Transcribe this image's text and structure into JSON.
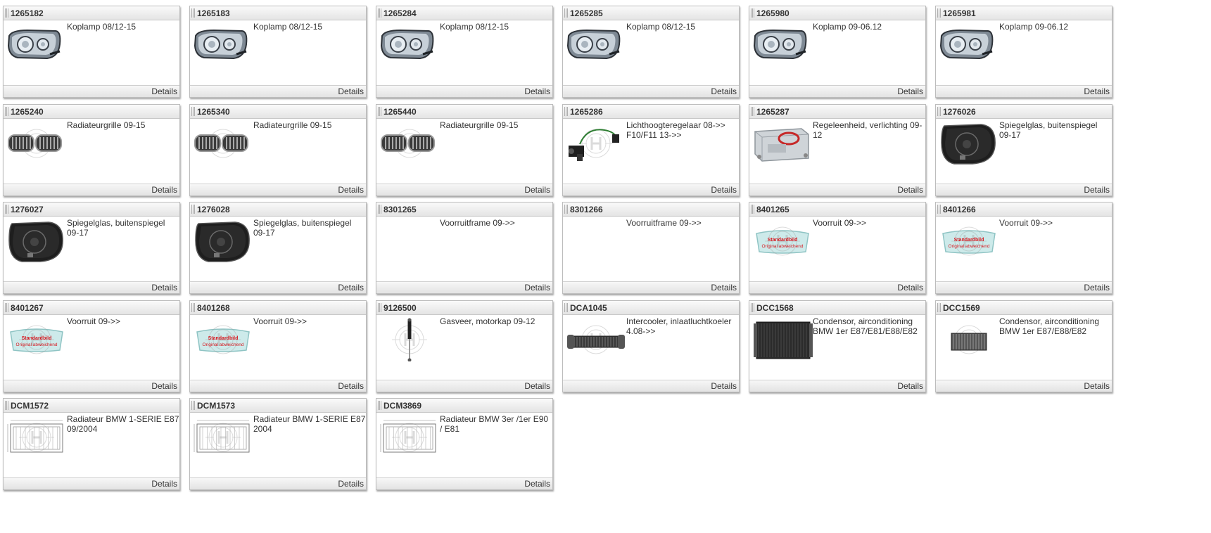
{
  "details_label": "Details",
  "watermark_badge": {
    "line1": "Standardbild",
    "line2": "Original abweichend"
  },
  "colors": {
    "card_border": "#bdbdbd",
    "header_bg": "#e8e8e8",
    "text": "#333333",
    "badge_red": "#d71920"
  },
  "products": [
    {
      "id": "1265182",
      "description": "Koplamp 08/12-15",
      "icon": "headlamp-icon"
    },
    {
      "id": "1265183",
      "description": "Koplamp 08/12-15",
      "icon": "headlamp-icon"
    },
    {
      "id": "1265284",
      "description": "Koplamp 08/12-15",
      "icon": "headlamp-icon"
    },
    {
      "id": "1265285",
      "description": "Koplamp 08/12-15",
      "icon": "headlamp-icon"
    },
    {
      "id": "1265980",
      "description": "Koplamp 09-06.12",
      "icon": "headlamp-icon"
    },
    {
      "id": "1265981",
      "description": "Koplamp 09-06.12",
      "icon": "headlamp-icon"
    },
    {
      "id": "1265240",
      "description": "Radiateurgrille 09-15",
      "icon": "kidney-grille-icon"
    },
    {
      "id": "1265340",
      "description": "Radiateurgrille 09-15",
      "icon": "kidney-grille-icon"
    },
    {
      "id": "1265440",
      "description": "Radiateurgrille 09-15",
      "icon": "kidney-grille-icon"
    },
    {
      "id": "1265286",
      "description": "Lichthoogteregelaar 08->> F10/F11 13->>",
      "icon": "headlight-leveling-motor-icon"
    },
    {
      "id": "1265287",
      "description": "Regeleenheid, verlichting 09-12",
      "icon": "control-unit-icon"
    },
    {
      "id": "1276026",
      "description": "Spiegelglas, buitenspiegel 09-17",
      "icon": "mirror-glass-icon"
    },
    {
      "id": "1276027",
      "description": "Spiegelglas, buitenspiegel 09-17",
      "icon": "mirror-glass-icon"
    },
    {
      "id": "1276028",
      "description": "Spiegelglas, buitenspiegel 09-17",
      "icon": "mirror-glass-icon"
    },
    {
      "id": "8301265",
      "description": "Voorruitframe 09->>",
      "icon": "none"
    },
    {
      "id": "8301266",
      "description": "Voorruitframe 09->>",
      "icon": "none"
    },
    {
      "id": "8401265",
      "description": "Voorruit 09->>",
      "icon": "windshield-icon"
    },
    {
      "id": "8401266",
      "description": "Voorruit 09->>",
      "icon": "windshield-icon"
    },
    {
      "id": "8401267",
      "description": "Voorruit 09->>",
      "icon": "windshield-icon"
    },
    {
      "id": "8401268",
      "description": "Voorruit 09->>",
      "icon": "windshield-icon"
    },
    {
      "id": "9126500",
      "description": "Gasveer, motorkap 09-12",
      "icon": "gas-spring-icon"
    },
    {
      "id": "DCA1045",
      "description": "Intercooler, inlaatluchtkoeler 4.08->>",
      "icon": "intercooler-icon"
    },
    {
      "id": "DCC1568",
      "description": "Condensor, airconditioning BMW 1er E87/E81/E88/E82",
      "icon": "condenser-icon"
    },
    {
      "id": "DCC1569",
      "description": "Condensor, airconditioning BMW 1er E87/E88/E82",
      "icon": "condenser-small-icon"
    },
    {
      "id": "DCM1572",
      "description": "Radiateur BMW 1-SERIE E87 09/2004",
      "icon": "radiator-drawing-icon"
    },
    {
      "id": "DCM1573",
      "description": "Radiateur BMW 1-SERIE E87 2004",
      "icon": "radiator-drawing-icon"
    },
    {
      "id": "DCM3869",
      "description": "Radiateur BMW 3er /1er E90 / E81",
      "icon": "radiator-drawing-icon"
    }
  ]
}
